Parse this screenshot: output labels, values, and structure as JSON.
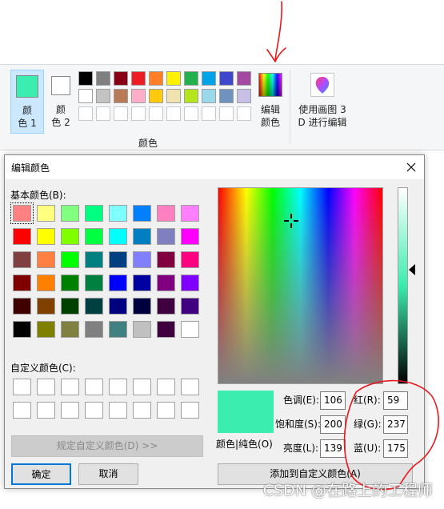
{
  "ribbon": {
    "color1_label": "颜\n色 1",
    "color1_value": "#3bedaf",
    "color2_label": "颜\n色 2",
    "color2_value": "#ffffff",
    "group_label": "颜色",
    "edit_colors_label": "编辑\n颜色",
    "paint3d_label": "使用画图 3\nD 进行编辑",
    "palette_row1": [
      "#000000",
      "#7f7f7f",
      "#880015",
      "#ed1c24",
      "#ff7f27",
      "#fff200",
      "#22b14c",
      "#00a2e8",
      "#3f48cc",
      "#a349a4"
    ],
    "palette_row2": [
      "#ffffff",
      "#c3c3c3",
      "#b97a57",
      "#ffaec9",
      "#ffc90e",
      "#efe4b0",
      "#b5e61d",
      "#99d9ea",
      "#7092be",
      "#c8bfe7"
    ]
  },
  "dialog": {
    "title": "编辑颜色",
    "close_icon": "close-icon",
    "basic_colors_label": "基本颜色(B):",
    "custom_colors_label": "自定义颜色(C):",
    "define_custom_label": "规定自定义颜色(D) >>",
    "ok_label": "确定",
    "cancel_label": "取消",
    "color_solid_label": "颜色|纯色(O)",
    "add_custom_label": "添加到自定义颜色(A)",
    "hue_label": "色调(E):",
    "hue_value": "106",
    "sat_label": "饱和度(S):",
    "sat_value": "200",
    "lum_label": "亮度(L):",
    "lum_value": "139",
    "red_label": "红(R):",
    "red_value": "59",
    "green_label": "绿(G):",
    "green_value": "237",
    "blue_label": "蓝(U):",
    "blue_value": "175",
    "current_color": "#3bedaf",
    "basic_colors": [
      [
        "#ff8080",
        "#ffff80",
        "#80ff80",
        "#00ff80",
        "#80ffff",
        "#0080ff",
        "#ff80c0",
        "#ff80ff"
      ],
      [
        "#ff0000",
        "#ffff00",
        "#80ff00",
        "#00ff40",
        "#00ffff",
        "#0080c0",
        "#8080c0",
        "#ff00ff"
      ],
      [
        "#804040",
        "#ff8040",
        "#00ff00",
        "#008080",
        "#004080",
        "#8080ff",
        "#800040",
        "#ff0080"
      ],
      [
        "#800000",
        "#ff8000",
        "#008000",
        "#008040",
        "#0000ff",
        "#0000a0",
        "#800080",
        "#8000ff"
      ],
      [
        "#400000",
        "#804000",
        "#004000",
        "#004040",
        "#000080",
        "#000040",
        "#400040",
        "#400080"
      ],
      [
        "#000000",
        "#808000",
        "#808040",
        "#808080",
        "#408080",
        "#c0c0c0",
        "#400040",
        "#ffffff"
      ]
    ]
  },
  "watermark": "CSDN @在路上的工程师",
  "annotation_color": "#e8191e"
}
